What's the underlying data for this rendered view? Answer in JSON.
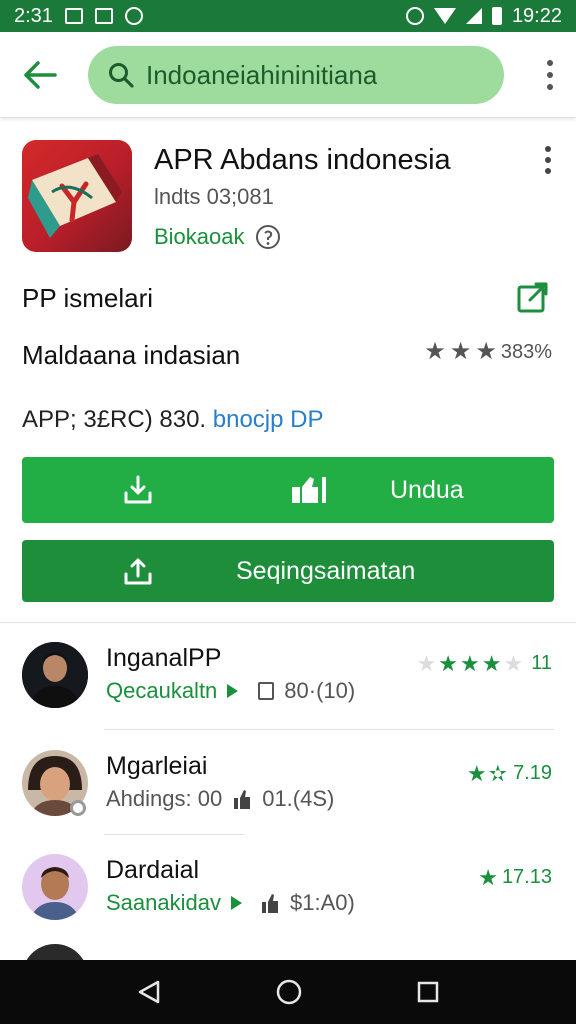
{
  "status_bar": {
    "time_left": "2:31",
    "time_right": "19:22"
  },
  "search": {
    "query": "Indoaneiahininitiana"
  },
  "app": {
    "title": "APR Abdans indonesia",
    "subtitle": "lndts 03;081",
    "developer": "Biokaoak",
    "section_label": "PP ismelari",
    "category": "Maldaana indasian",
    "rating_text": "383%",
    "price_prefix": "APP; 3£RC) 830.",
    "price_link": "bnocjp DP"
  },
  "buttons": {
    "primary_label": "Undua",
    "secondary_label": "Seqingsaimatan"
  },
  "reviews": [
    {
      "name": "InganalPP",
      "sub_green": "Qecaukaltn",
      "sub_grey": "80·(10)",
      "rating_text": "11",
      "stars": 3
    },
    {
      "name": "Mgarleiai",
      "sub_green": "",
      "sub_grey": "Ahdings: 00",
      "sub_grey2": "01.(4S)",
      "rating_text": "7.19"
    },
    {
      "name": "Dardaial",
      "sub_green": "Saanakidav",
      "sub_grey": "$1:A0)",
      "rating_text": "17.13"
    }
  ],
  "colors": {
    "status_bar": "#1b7a3a",
    "search_fill": "#9edc9e",
    "primary": "#22ad45",
    "secondary": "#1f8e3a",
    "accent_green": "#1a8f3c"
  }
}
